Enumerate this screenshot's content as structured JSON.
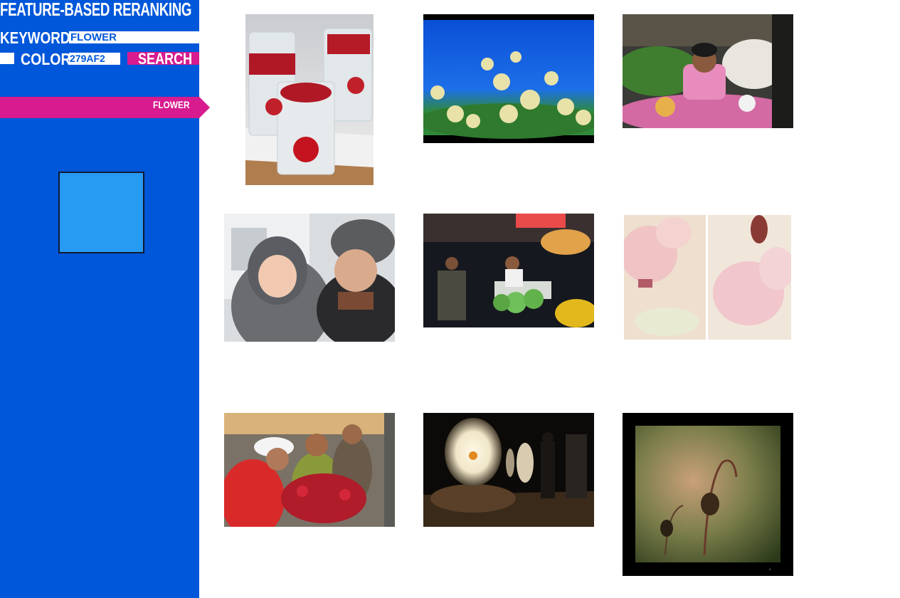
{
  "app": {
    "title": "FEATURE-BASED RERANKING"
  },
  "search": {
    "keyword_label": "KEYWORD",
    "keyword_value": "FLOWER",
    "color_label": "COLOR",
    "color_value": "279AF2",
    "search_label": "SEARCH"
  },
  "tag": {
    "label": "FLOWER"
  },
  "swatch": {
    "color": "#279AF2"
  },
  "colors": {
    "sidebar": "#0057D9",
    "accent": "#D81B8F"
  },
  "results": [
    {
      "subject": "glass candle holders with red roses"
    },
    {
      "subject": "white flowers against blue sky"
    },
    {
      "subject": "woman at flower market stall"
    },
    {
      "subject": "baby and man in winter hats"
    },
    {
      "subject": "night flower market"
    },
    {
      "subject": "pink peonies diptych"
    },
    {
      "subject": "people at red flower market"
    },
    {
      "subject": "flower projection in dark room"
    },
    {
      "subject": "drooping flower bud, framed"
    }
  ]
}
